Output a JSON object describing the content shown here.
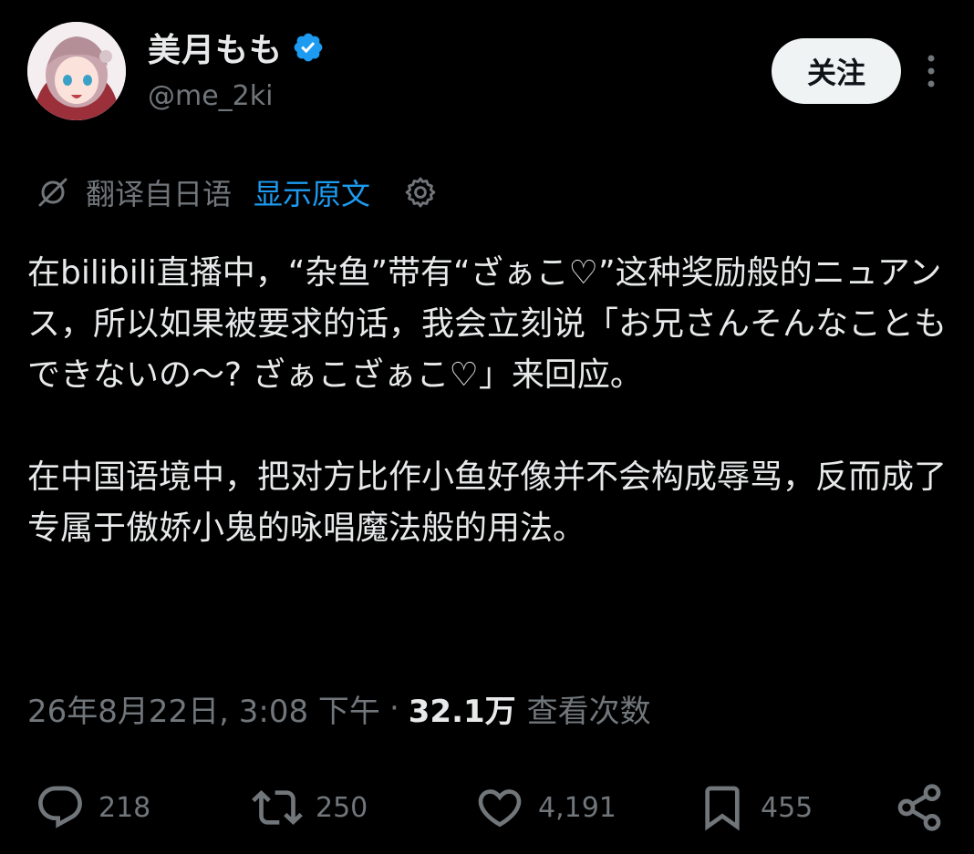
{
  "author": {
    "display_name": "美月もも",
    "handle": "@me_2ki",
    "verified_color": "#1d9bf0"
  },
  "header": {
    "follow_label": "关注"
  },
  "translation": {
    "label": "翻译自日语",
    "show_original_label": "显示原文"
  },
  "tweet": {
    "paragraphs": [
      "在bilibili直播中，“杂鱼”带有“ざぁこ♡”这种奖励般的ニュアンス，所以如果被要求的话，我会立刻说「お兄さんそんなこともできないの〜? ざぁこざぁこ♡」来回应。",
      "在中国语境中，把对方比作小鱼好像并不会构成辱骂，反而成了专属于傲娇小鬼的咏唱魔法般的用法。"
    ]
  },
  "meta": {
    "timestamp": "26年8月22日, 3:08 下午",
    "separator": "·",
    "views_count": "32.1万",
    "views_label": "查看次数"
  },
  "actions": {
    "replies": "218",
    "reposts": "250",
    "likes": "4,191",
    "bookmarks": "455"
  },
  "colors": {
    "background": "#000000",
    "text_primary": "#e7e9ea",
    "text_secondary": "#71767b",
    "accent": "#1d9bf0",
    "follow_bg": "#eff3f4"
  }
}
